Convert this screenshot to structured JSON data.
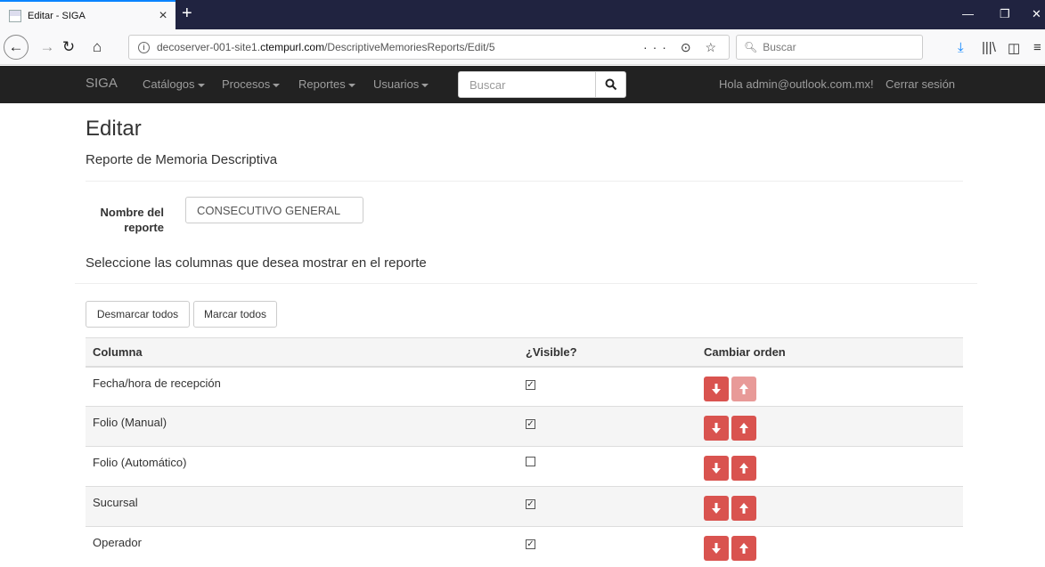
{
  "browser": {
    "tab_title": "Editar - SIGA",
    "url_prefix": "decoserver-001-site1.",
    "url_host": "ctempurl.com",
    "url_path": "/DescriptiveMemoriesReports/Edit/5",
    "search_placeholder": "Buscar",
    "url_right_icons": "··· ⊙ ☆"
  },
  "appnav": {
    "brand": "SIGA",
    "menus": [
      "Catálogos",
      "Procesos",
      "Reportes",
      "Usuarios"
    ],
    "search_placeholder": "Buscar",
    "greeting": "Hola admin@outlook.com.mx!",
    "logout": "Cerrar sesión"
  },
  "page": {
    "title": "Editar",
    "subtitle": "Reporte de Memoria Descriptiva",
    "name_label": "Nombre del reporte",
    "name_value": "CONSECUTIVO GENERAL",
    "select_text": "Seleccione las columnas que desea mostrar en el reporte",
    "uncheck_all": "Desmarcar todos",
    "check_all": "Marcar todos"
  },
  "table": {
    "headers": [
      "Columna",
      "¿Visible?",
      "Cambiar orden"
    ],
    "rows": [
      {
        "name": "Fecha/hora de recepción",
        "visible": true,
        "up_enabled": false
      },
      {
        "name": "Folio (Manual)",
        "visible": true,
        "up_enabled": true
      },
      {
        "name": "Folio (Automático)",
        "visible": false,
        "up_enabled": true
      },
      {
        "name": "Sucursal",
        "visible": true,
        "up_enabled": true
      },
      {
        "name": "Operador",
        "visible": true,
        "up_enabled": true
      }
    ]
  },
  "colors": {
    "navbar_bg": "#222222",
    "danger": "#d9534f"
  }
}
